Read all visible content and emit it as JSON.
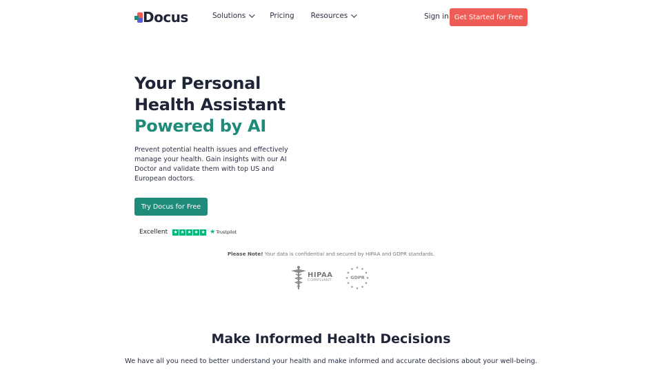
{
  "header": {
    "logo_text": "Docus",
    "nav": [
      {
        "label": "Solutions",
        "has_dropdown": true
      },
      {
        "label": "Pricing",
        "has_dropdown": false
      },
      {
        "label": "Resources",
        "has_dropdown": true
      }
    ],
    "sign_in": "Sign in",
    "cta": "Get Started for Free"
  },
  "hero": {
    "title_line1": "Your Personal",
    "title_line2": "Health Assistant",
    "title_accent": "Powered by AI",
    "description": "Prevent potential health issues and effectively manage your health. Gain insights with our AI Doctor and validate them with top US and European doctors.",
    "cta": "Try Docus for Free",
    "trustpilot": {
      "label": "Excellent",
      "stars": 5,
      "brand": "Trustpilot"
    }
  },
  "note": {
    "bold": "Please Note!",
    "text": " Your data is confidential and secured by HIPAA and GDPR standards."
  },
  "badges": {
    "hipaa_title": "HIPAA",
    "hipaa_sub": "COMPLIANT",
    "gdpr": "GDPR"
  },
  "section": {
    "title": "Make Informed Health Decisions",
    "description": "We have all you need to better understand your health and make informed and accurate decisions about your well-being."
  },
  "colors": {
    "primary_teal": "#1e8a7a",
    "cta_red": "#ef5b55",
    "text_dark": "#1f2437",
    "trustpilot_green": "#00b67a"
  }
}
